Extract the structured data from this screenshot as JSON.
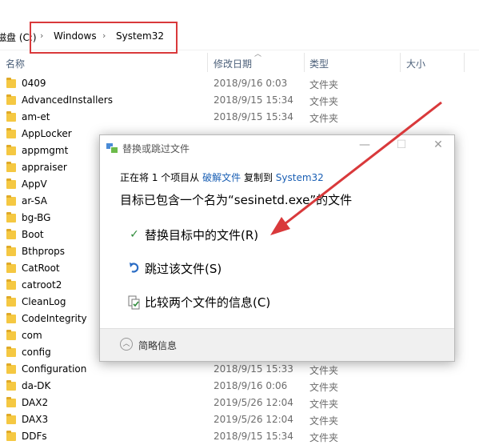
{
  "breadcrumb": {
    "drive": "磁盘 (C:)",
    "folder1": "Windows",
    "folder2": "System32",
    "separator": "›"
  },
  "columns": {
    "name": "名称",
    "date": "修改日期",
    "type": "类型",
    "size": "大小"
  },
  "files": [
    {
      "name": "0409",
      "date": "2018/9/16 0:03",
      "type": "文件夹"
    },
    {
      "name": "AdvancedInstallers",
      "date": "2018/9/15 15:34",
      "type": "文件夹"
    },
    {
      "name": "am-et",
      "date": "2018/9/15 15:34",
      "type": "文件夹"
    },
    {
      "name": "AppLocker",
      "date": "",
      "type": ""
    },
    {
      "name": "appmgmt",
      "date": "",
      "type": ""
    },
    {
      "name": "appraiser",
      "date": "",
      "type": ""
    },
    {
      "name": "AppV",
      "date": "",
      "type": ""
    },
    {
      "name": "ar-SA",
      "date": "",
      "type": ""
    },
    {
      "name": "bg-BG",
      "date": "",
      "type": ""
    },
    {
      "name": "Boot",
      "date": "",
      "type": ""
    },
    {
      "name": "Bthprops",
      "date": "",
      "type": ""
    },
    {
      "name": "CatRoot",
      "date": "",
      "type": ""
    },
    {
      "name": "catroot2",
      "date": "",
      "type": ""
    },
    {
      "name": "CleanLog",
      "date": "",
      "type": ""
    },
    {
      "name": "CodeIntegrity",
      "date": "",
      "type": ""
    },
    {
      "name": "com",
      "date": "",
      "type": ""
    },
    {
      "name": "config",
      "date": "",
      "type": ""
    },
    {
      "name": "Configuration",
      "date": "2018/9/15 15:33",
      "type": "文件夹"
    },
    {
      "name": "da-DK",
      "date": "2018/9/16 0:06",
      "type": "文件夹"
    },
    {
      "name": "DAX2",
      "date": "2019/5/26 12:04",
      "type": "文件夹"
    },
    {
      "name": "DAX3",
      "date": "2019/5/26 12:04",
      "type": "文件夹"
    },
    {
      "name": "DDFs",
      "date": "2018/9/15 15:34",
      "type": "文件夹"
    }
  ],
  "dialog": {
    "title": "替换或跳过文件",
    "line1_prefix": "正在将 1 个项目从",
    "line1_source": "破解文件",
    "line1_mid": "复制到",
    "line1_dest": "System32",
    "line2": "目标已包含一个名为“sesinetd.exe”的文件",
    "opt_replace": "替换目标中的文件(R)",
    "opt_skip": "跳过该文件(S)",
    "opt_compare": "比较两个文件的信息(C)",
    "details": "简略信息",
    "icons": {
      "replace": "check-icon",
      "skip": "skip-arrow-icon",
      "compare": "compare-files-icon"
    },
    "btn_minimize": "—",
    "btn_maximize": "☐",
    "btn_close": "✕"
  },
  "colors": {
    "accent": "#1a5fb4",
    "annotation": "#d9393b",
    "folder": "#f5c842"
  }
}
